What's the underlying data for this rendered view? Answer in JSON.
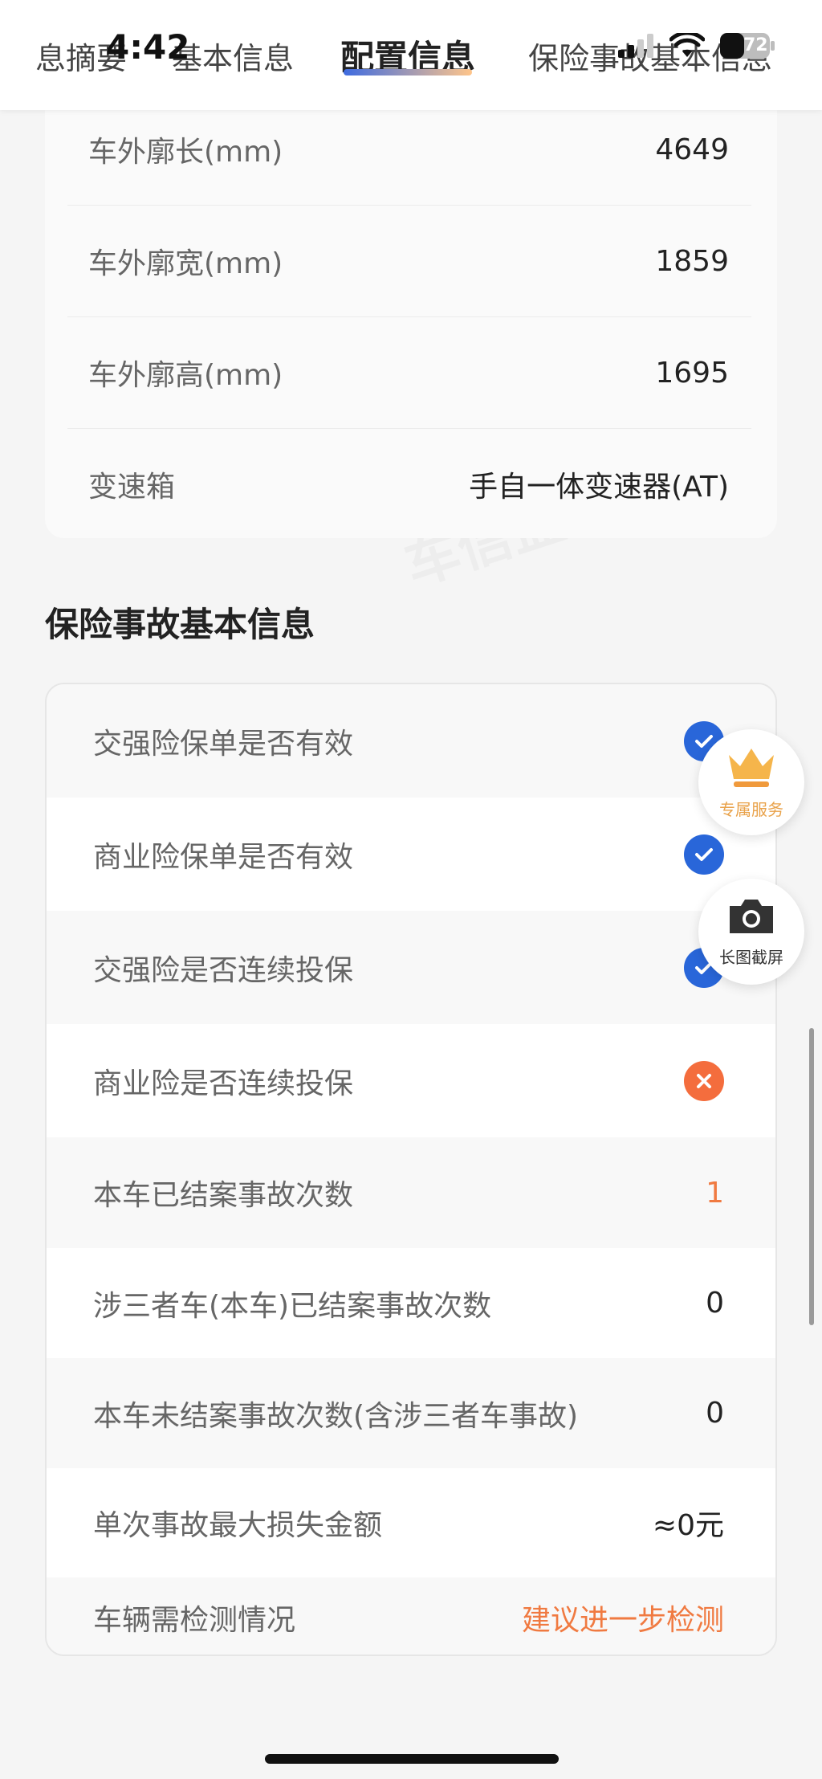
{
  "status_bar": {
    "time": "4:42",
    "battery": "72"
  },
  "tabs": [
    {
      "label": "息摘要"
    },
    {
      "label": "基本信息"
    },
    {
      "label": "配置信息",
      "active": true
    },
    {
      "label": "保险事故基本信息"
    }
  ],
  "config_rows": [
    {
      "label": "车外廓长(mm)",
      "value": "4649"
    },
    {
      "label": "车外廓宽(mm)",
      "value": "1859"
    },
    {
      "label": "车外廓高(mm)",
      "value": "1695"
    },
    {
      "label": "变速箱",
      "value": "手自一体变速器(AT)"
    }
  ],
  "insurance_section_title": "保险事故基本信息",
  "insurance_rows": [
    {
      "label": "交强险保单是否有效",
      "status": "yes"
    },
    {
      "label": "商业险保单是否有效",
      "status": "yes"
    },
    {
      "label": "交强险是否连续投保",
      "status": "yes"
    },
    {
      "label": "商业险是否连续投保",
      "status": "no"
    },
    {
      "label": "本车已结案事故次数",
      "value": "1"
    },
    {
      "label": "涉三者车(本车)已结案事故次数",
      "value": "0"
    },
    {
      "label": "本车未结案事故次数(含涉三者车事故)",
      "value": "0"
    },
    {
      "label": "单次事故最大损失金额",
      "value": "≈0元"
    },
    {
      "label": "车辆需检测情况",
      "value": "建议进一步检测"
    }
  ],
  "float_buttons": {
    "exclusive_service": "专属服务",
    "long_screenshot": "长图截屏"
  },
  "colors": {
    "accent_blue": "#2966d9",
    "accent_orange": "#f07a41",
    "gold": "#e9a24a"
  }
}
